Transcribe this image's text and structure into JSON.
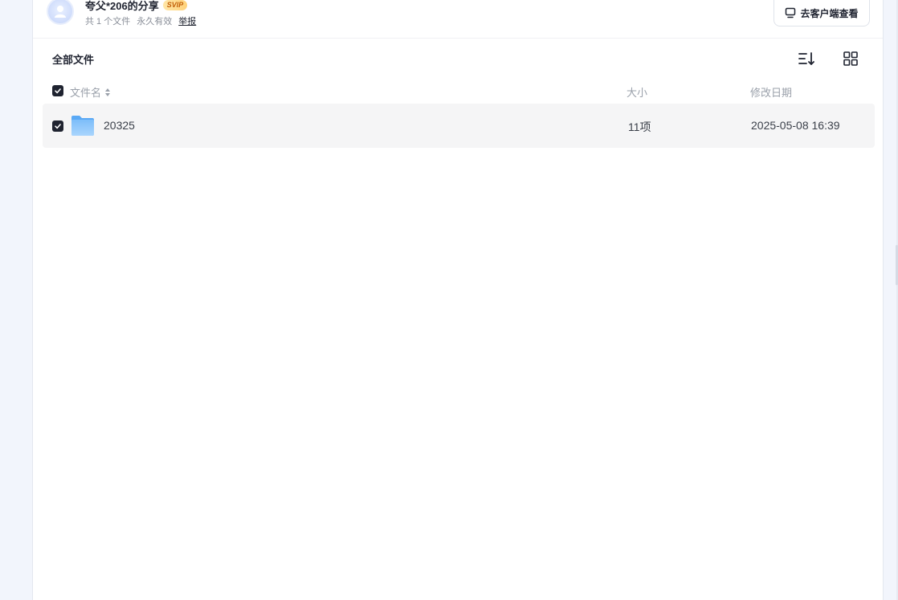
{
  "share": {
    "title": "夸父*206的分享",
    "badge": "SVIP",
    "file_count": "共 1 个文件",
    "validity": "永久有效",
    "report": "举报",
    "client_button": "去客户端查看"
  },
  "toolbar": {
    "breadcrumb": "全部文件",
    "icons": [
      "sort-icon",
      "grid-view-icon"
    ]
  },
  "table": {
    "columns": {
      "name": "文件名",
      "size": "大小",
      "date": "修改日期"
    },
    "rows": [
      {
        "name": "20325",
        "size": "11项",
        "date": "2025-05-08 16:39",
        "type": "folder",
        "checked": true
      }
    ]
  },
  "colors": {
    "accent_dark": "#1f2330",
    "row_bg": "#f5f5f6",
    "folder_blue": "#5aa9f5",
    "page_bg": "#f2f5fc"
  }
}
